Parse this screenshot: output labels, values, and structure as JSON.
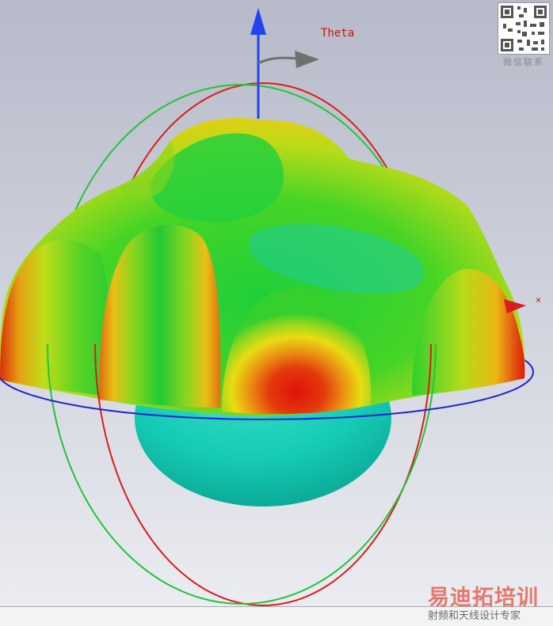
{
  "view": {
    "axis_label_theta": "Theta",
    "axis_label_x": "×"
  },
  "watermark": {
    "qr_caption": "微信联系",
    "title": "易迪拓培训",
    "subtitle": "射频和天线设计专家"
  },
  "colors": {
    "z_axis": "#2244ee",
    "theta_arrow": "#707070",
    "ring_red": "#dc1c1c",
    "ring_green": "#22c43a",
    "ring_blue": "#2222d2",
    "pattern_low": "#13cfb8",
    "pattern_mid": "#2fd63a",
    "pattern_high": "#f2e20e",
    "pattern_peak": "#e0140a"
  }
}
